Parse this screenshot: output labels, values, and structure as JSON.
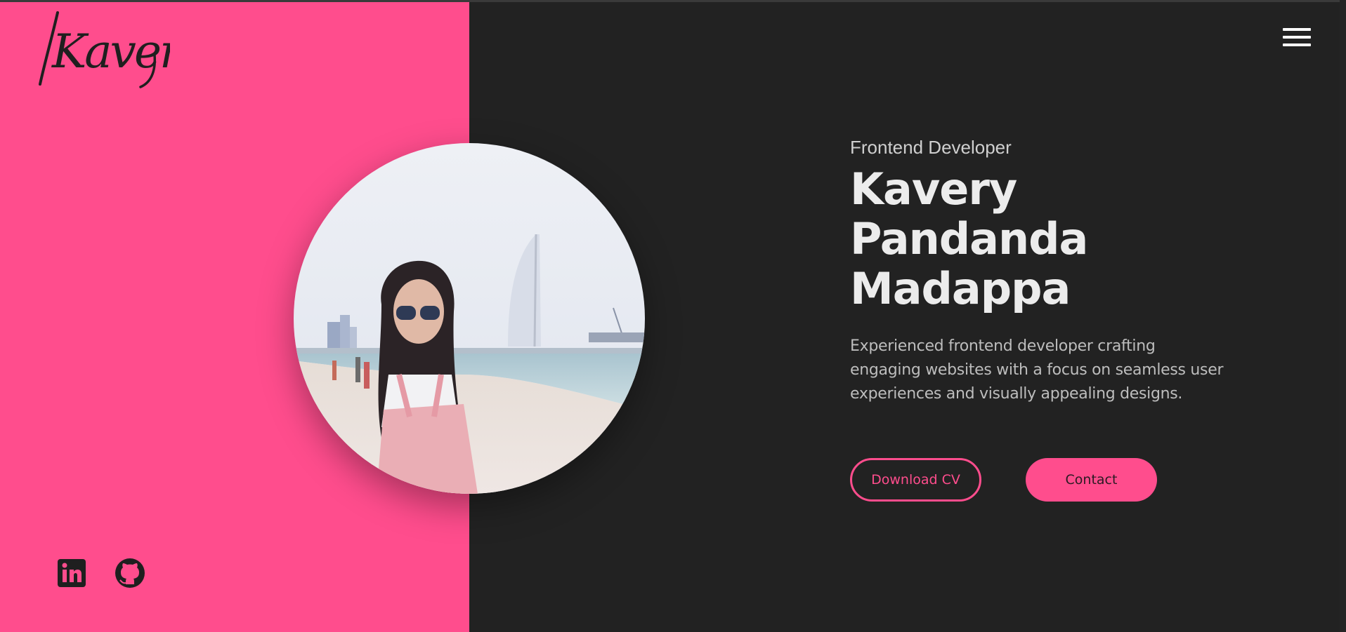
{
  "brand": {
    "logo_text": "Kavery"
  },
  "header": {
    "menu_icon": "hamburger-menu-icon"
  },
  "hero": {
    "subtitle": "Frontend Developer",
    "name_lines": [
      "Kavery",
      "Pandanda",
      "Madappa"
    ],
    "description": "Experienced frontend developer crafting engaging websites with a focus on seamless user experiences and visually appealing designs.",
    "buttons": {
      "download_cv": "Download CV",
      "contact": "Contact"
    }
  },
  "social": [
    {
      "name": "LinkedIn",
      "icon": "linkedin-icon"
    },
    {
      "name": "GitHub",
      "icon": "github-icon"
    }
  ],
  "colors": {
    "accent": "#ff4d8d",
    "background": "#222222",
    "heading": "#ececec",
    "body_text": "#bdbdbd",
    "logo_ink": "#1f1f1f"
  }
}
